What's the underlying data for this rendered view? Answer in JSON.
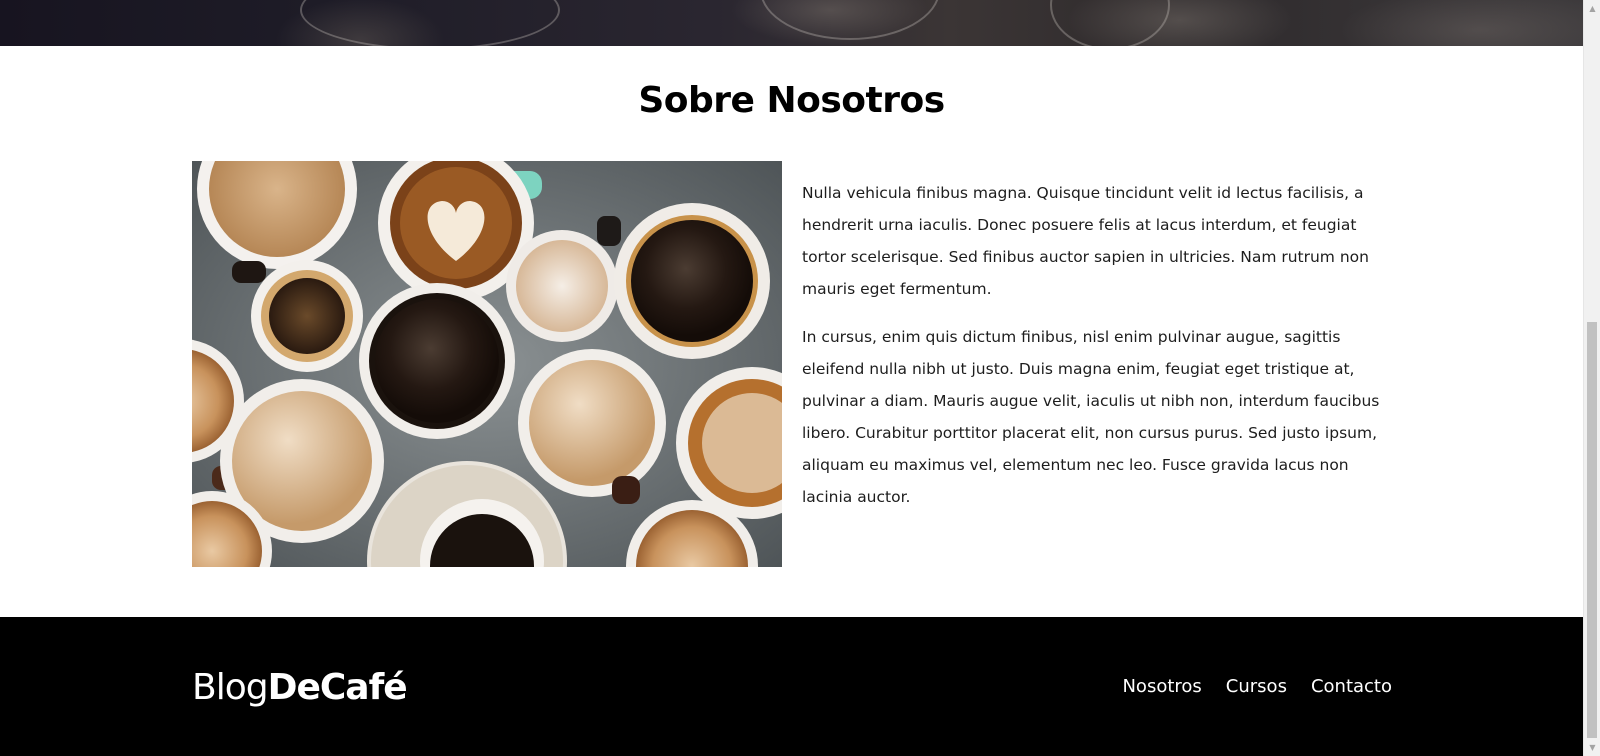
{
  "about": {
    "title": "Sobre Nosotros",
    "paragraphs": [
      "Nulla vehicula finibus magna. Quisque tincidunt velit id lectus facilisis, a hendrerit urna iaculis. Donec posuere felis at lacus interdum, et feugiat tortor scelerisque. Sed finibus auctor sapien in ultricies. Nam rutrum non mauris eget fermentum.",
      "In cursus, enim quis dictum finibus, nisl enim pulvinar augue, sagittis eleifend nulla nibh ut justo. Duis magna enim, feugiat eget tristique at, pulvinar a diam. Mauris augue velit, iaculis ut nibh non, interdum faucibus libero. Curabitur porttitor placerat elit, non cursus purus. Sed justo ipsum, aliquam eu maximus vel, elementum nec leo. Fusce gravida lacus non lacinia auctor."
    ]
  },
  "footer": {
    "logo_light": "Blog",
    "logo_bold": "DeCafé",
    "nav": [
      "Nosotros",
      "Cursos",
      "Contacto"
    ]
  },
  "icons": {
    "scroll_up": "up-arrow-icon",
    "scroll_down": "down-arrow-icon"
  },
  "colors": {
    "footer_bg": "#000000",
    "text": "#1d1d1d"
  }
}
